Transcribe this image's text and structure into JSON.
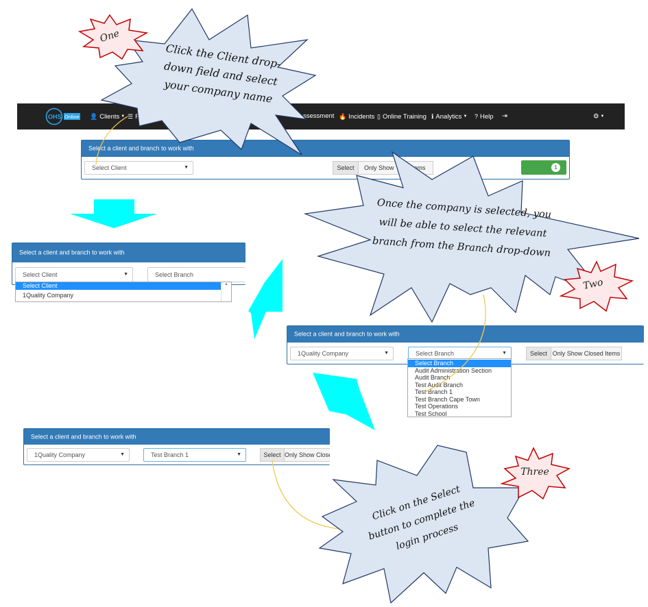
{
  "navbar": {
    "brand_ohs": "OHS",
    "brand_suffix": "Online",
    "items": [
      {
        "icon": "user-icon",
        "label": "Clients"
      },
      {
        "icon": "list-icon",
        "label": "Reg"
      },
      {
        "icon": "",
        "label": "ssessment"
      },
      {
        "icon": "fire-icon",
        "label": "Incidents"
      },
      {
        "icon": "book-icon",
        "label": "Online Training"
      },
      {
        "icon": "info-icon",
        "label": "Analytics"
      },
      {
        "icon": "help-icon",
        "label": "Help"
      }
    ],
    "logout_icon": "logout-icon",
    "settings_icon": "gear-icon"
  },
  "panel1": {
    "heading": "Select a client and branch to work with",
    "client_select": "Select Client",
    "select_button": "Select",
    "closed_button": "Only Show",
    "closed_button_tail": "Items",
    "badge_count": "1"
  },
  "panel2": {
    "heading": "Select a client and branch to work with",
    "client_select": "Select Client",
    "branch_select": "Select Branch",
    "options": [
      "Select Client",
      "1Quality Company"
    ]
  },
  "panel3": {
    "heading": "Select a client and branch to work with",
    "client_select": "1Quality Company",
    "branch_select": "Select Branch",
    "select_button": "Select",
    "closed_button": "Only Show Closed Items",
    "options": [
      "Select Branch",
      "Audit Administration Section",
      "Audit Branch",
      "Test Audit Branch",
      "Test Branch 1",
      "Test Branch Cape Town",
      "Test Operations",
      "Test School"
    ]
  },
  "panel4": {
    "heading": "Select a client and branch to work with",
    "client_select": "1Quality Company",
    "branch_select": "Test Branch 1",
    "select_button": "Select",
    "closed_button": "Only Show Close"
  },
  "callouts": {
    "one_label": "One",
    "two_label": "Two",
    "three_label": "Three",
    "one_lines": [
      "Click the Client drop-",
      "down field and select",
      "your company name"
    ],
    "two_lines": [
      "Once the company is selected, you",
      "will be able to select the relevant",
      "branch from the Branch drop-down"
    ],
    "three_lines": [
      "Click on the Select",
      "button to complete the",
      "login process"
    ]
  },
  "colors": {
    "navbar": "#222222",
    "panel_header": "#337ab7",
    "callout_fill": "#dce6f2",
    "callout_stroke": "#1f3864",
    "label_fill": "#fde9e9",
    "label_stroke": "#c00000",
    "arrow_cyan": "#00ffff",
    "badge_green": "#46a549",
    "highlight": "#1e90ff"
  }
}
